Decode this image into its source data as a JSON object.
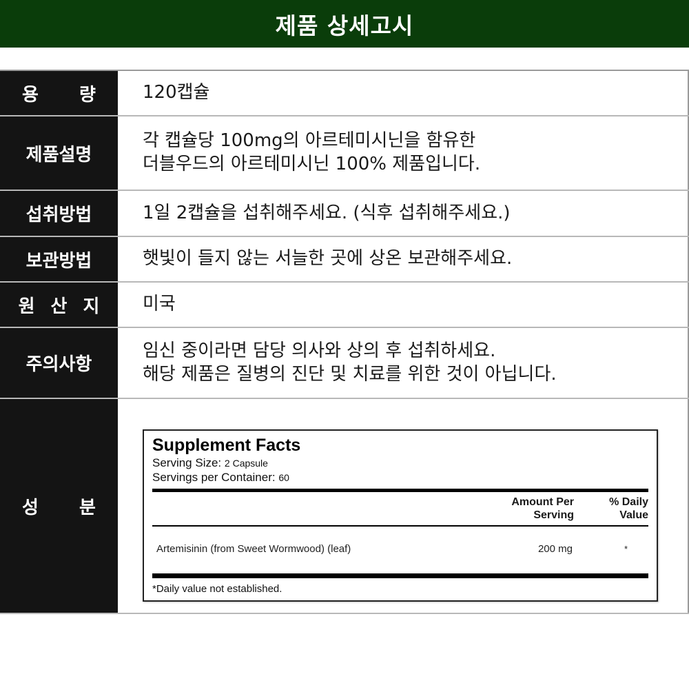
{
  "banner": {
    "title": "제품 상세고시"
  },
  "rows": [
    {
      "label": "용 량",
      "lines": [
        "120캡슐"
      ]
    },
    {
      "label": "제품설명",
      "lines": [
        "각 캡슐당 100mg의 아르테미시닌을 함유한",
        "더블우드의 아르테미시닌 100% 제품입니다."
      ]
    },
    {
      "label": "섭취방법",
      "lines": [
        "1일 2캡슐을 섭취해주세요. (식후 섭취해주세요.)"
      ]
    },
    {
      "label": "보관방법",
      "lines": [
        "햇빛이 들지 않는 서늘한 곳에 상온 보관해주세요."
      ]
    },
    {
      "label": "원 산 지",
      "lines": [
        "미국"
      ]
    },
    {
      "label": "주의사항",
      "lines": [
        "임신 중이라면 담당 의사와 상의 후 섭취하세요.",
        "해당 제품은 질병의 진단 및 치료를 위한 것이 아닙니다."
      ]
    },
    {
      "label": "성 분"
    }
  ],
  "supplement_facts": {
    "title": "Supplement Facts",
    "serving_size_label": "Serving Size:",
    "serving_size_value": "2 Capsule",
    "servings_label": "Servings per Container:",
    "servings_value": "60",
    "col_amount_1": "Amount Per",
    "col_amount_2": "Serving",
    "col_dv_1": "% Daily",
    "col_dv_2": "Value",
    "ingredient": "Artemisinin (from Sweet Wormwood) (leaf)",
    "amount": "200 mg",
    "daily_value": "*",
    "footnote": "*Daily value not established."
  }
}
